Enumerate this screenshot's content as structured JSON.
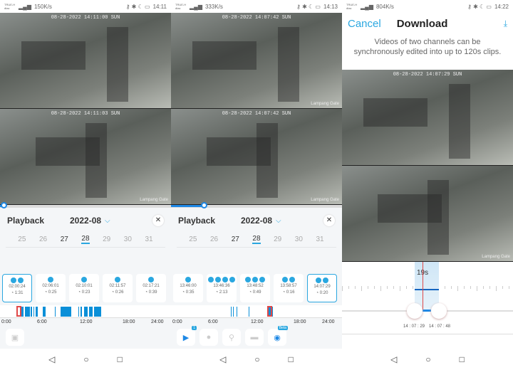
{
  "panels": [
    {
      "status": {
        "carrier": "TRUE-H dtac",
        "speed": "150K/s",
        "time": "14:11"
      },
      "feeds": [
        {
          "timestamp": "08-28-2022 14:11:00 SUN",
          "camera": ""
        },
        {
          "timestamp": "08-28-2022 14:11:03 SUN",
          "camera": "Lampang Gate"
        }
      ],
      "progress": 0.02,
      "playback": {
        "title": "Playback",
        "month": "2022-08",
        "days": [
          "25",
          "26",
          "27",
          "28",
          "29",
          "30",
          "31"
        ],
        "selected_day": "28",
        "clips": [
          {
            "time": "02:00:24",
            "duration": "1:31",
            "icons": 2,
            "selected": true
          },
          {
            "time": "02:06:01",
            "duration": "0:25",
            "icons": 1
          },
          {
            "time": "02:10:01",
            "duration": "0:23",
            "icons": 1
          },
          {
            "time": "02:11:57",
            "duration": "0:26",
            "icons": 1
          },
          {
            "time": "02:17:21",
            "duration": "0:39",
            "icons": 1
          }
        ],
        "timeline": {
          "labels": [
            "0:00",
            "6:00",
            "12:00",
            "18:00",
            "24:00"
          ],
          "segments_hours": [
            [
              2.8,
              3.3
            ],
            [
              3.5,
              4.2
            ],
            [
              4.3,
              4.5
            ],
            [
              4.7,
              4.8
            ],
            [
              5.0,
              5.3
            ],
            [
              6.0,
              6.4
            ],
            [
              7.7,
              7.8
            ],
            [
              8.5,
              10.0
            ],
            [
              11.0,
              11.1
            ],
            [
              11.3,
              11.5
            ],
            [
              11.8,
              12.3
            ],
            [
              12.5,
              13.0
            ],
            [
              13.2,
              14.2
            ]
          ],
          "marker_hour": 2.6
        }
      },
      "tools": [
        {
          "icon": "snapshot-icon",
          "active": false
        }
      ]
    },
    {
      "status": {
        "carrier": "TRUE-H dtac",
        "speed": "333K/s",
        "time": "14:13"
      },
      "feeds": [
        {
          "timestamp": "08-28-2022 14:07:42 SUN",
          "camera": "Lampang Gate"
        },
        {
          "timestamp": "08-28-2022 14:07:42 SUN",
          "camera": "Lampang Gate"
        }
      ],
      "progress": 0.19,
      "playback": {
        "title": "Playback",
        "month": "2022-08",
        "days": [
          "25",
          "26",
          "27",
          "28",
          "29",
          "30",
          "31"
        ],
        "selected_day": "28",
        "clips": [
          {
            "time": "13:46:00",
            "duration": "0:35",
            "icons": 1
          },
          {
            "time": "13:46:36",
            "duration": "2:13",
            "icons": 4
          },
          {
            "time": "13:48:52",
            "duration": "0:49",
            "icons": 3
          },
          {
            "time": "13:58:57",
            "duration": "0:16",
            "icons": 2
          },
          {
            "time": "14:07:29",
            "duration": "0:20",
            "icons": 2,
            "selected": true
          }
        ],
        "timeline": {
          "labels": [
            "0:00",
            "6:00",
            "12:00",
            "18:00",
            "24:00"
          ],
          "segments_hours": [
            [
              8.4,
              8.5
            ],
            [
              8.7,
              8.8
            ],
            [
              9.2,
              9.3
            ],
            [
              10.9,
              11.0
            ],
            [
              13.6,
              14.3
            ]
          ],
          "marker_hour": 13.8
        }
      },
      "tools": [
        {
          "icon": "video-icon",
          "active": true,
          "badge": "1"
        },
        {
          "icon": "person-icon",
          "active": false
        },
        {
          "icon": "running-icon",
          "active": false
        },
        {
          "icon": "vehicle-icon",
          "active": false
        },
        {
          "icon": "ai-icon",
          "active": true,
          "beta": "Beta"
        }
      ]
    },
    {
      "status": {
        "carrier": "TRUE-H dtac",
        "speed": "804K/s",
        "time": "14:22"
      },
      "download": {
        "cancel": "Cancel",
        "title": "Download",
        "note": "Videos of two channels can be synchronously edited into up to 120s clips.",
        "duration": "19s",
        "start": "14 : 07 : 29",
        "end": "14 : 07 : 48"
      },
      "feeds": [
        {
          "timestamp": "08-28-2022 14:07:29 SUN",
          "camera": ""
        },
        {
          "timestamp": "",
          "camera": "Lampang Gate"
        }
      ]
    }
  ],
  "nav": {
    "back": "◁",
    "home": "○",
    "recent": "□"
  },
  "colors": {
    "accent": "#2aa7e0",
    "segment": "#0a8fd8",
    "marker": "#e04848"
  }
}
